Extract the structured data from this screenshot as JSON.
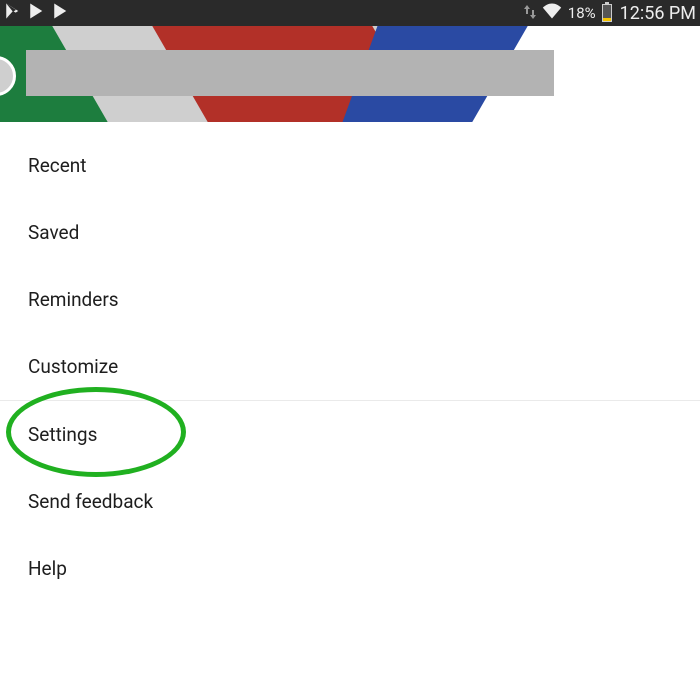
{
  "statusbar": {
    "battery_pct": "18%",
    "clock": "12:56 PM"
  },
  "menu": {
    "items": [
      {
        "label": "Recent"
      },
      {
        "label": "Saved"
      },
      {
        "label": "Reminders"
      },
      {
        "label": "Customize"
      },
      {
        "label": "Settings"
      },
      {
        "label": "Send feedback"
      },
      {
        "label": "Help"
      }
    ],
    "highlighted_index": 4
  },
  "colors": {
    "highlight": "#20b020"
  }
}
